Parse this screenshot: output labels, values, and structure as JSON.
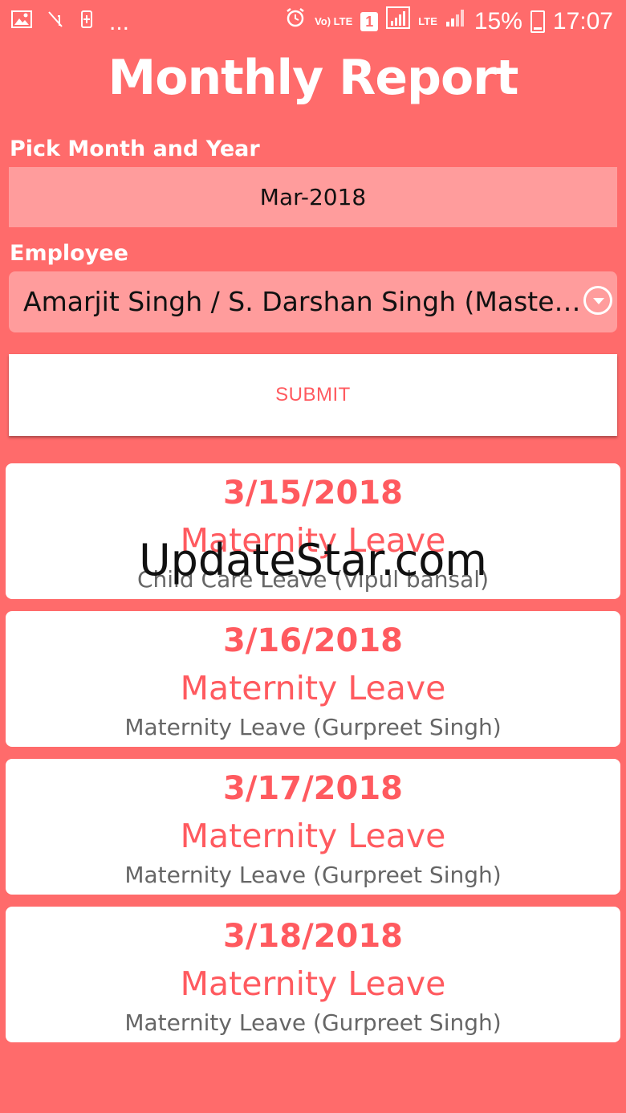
{
  "status_bar": {
    "left_icons": [
      "image-icon",
      "signal-off-icon",
      "battery-saver-icon",
      "more-icon"
    ],
    "more_text": "...",
    "volte_label": "Vo) LTE",
    "sim_label": "1",
    "lte_label": "LTE",
    "battery_percent": "15%",
    "time": "17:07"
  },
  "page": {
    "title": "Monthly Report"
  },
  "form": {
    "month_label": "Pick Month and Year",
    "month_value": "Mar-2018",
    "employee_label": "Employee",
    "employee_value": "Amarjit Singh / S. Darshan Singh (Master Cadre)",
    "submit_label": "SUBMIT"
  },
  "records": [
    {
      "date": "3/15/2018",
      "leave_type": "Maternity Leave",
      "detail": "Child Care Leave (Vipul bansal)"
    },
    {
      "date": "3/16/2018",
      "leave_type": "Maternity Leave",
      "detail": "Maternity Leave (Gurpreet Singh)"
    },
    {
      "date": "3/17/2018",
      "leave_type": "Maternity Leave",
      "detail": "Maternity Leave (Gurpreet Singh)"
    },
    {
      "date": "3/18/2018",
      "leave_type": "Maternity Leave",
      "detail": "Maternity Leave (Gurpreet Singh)"
    }
  ],
  "watermark": "UpdateStar.com",
  "colors": {
    "background": "#ff6b6b",
    "field_background": "#ff9c9c",
    "accent_text": "#ff5a5f",
    "detail_text": "#666666"
  }
}
